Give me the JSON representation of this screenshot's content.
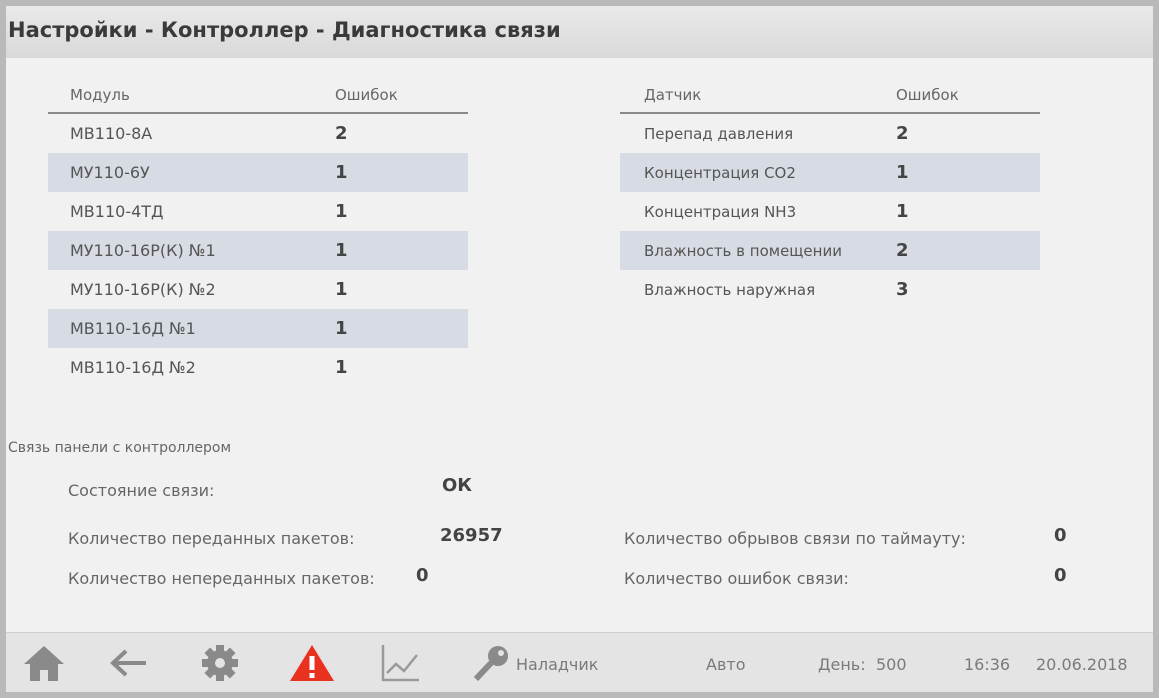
{
  "title": "Настройки - Контроллер - Диагностика связи",
  "modules_table": {
    "col_name": "Модуль",
    "col_errors": "Ошибок",
    "rows": [
      {
        "name": "МВ110-8А",
        "errors": "2"
      },
      {
        "name": "МУ110-6У",
        "errors": "1"
      },
      {
        "name": "МВ110-4ТД",
        "errors": "1"
      },
      {
        "name": "МУ110-16Р(К) №1",
        "errors": "1"
      },
      {
        "name": "МУ110-16Р(К) №2",
        "errors": "1"
      },
      {
        "name": "МВ110-16Д №1",
        "errors": "1"
      },
      {
        "name": "МВ110-16Д №2",
        "errors": "1"
      }
    ]
  },
  "sensors_table": {
    "col_name": "Датчик",
    "col_errors": "Ошибок",
    "rows": [
      {
        "name": "Перепад давления",
        "errors": "2"
      },
      {
        "name": "Концентрация СО2",
        "errors": "1"
      },
      {
        "name": "Концентрация NH3",
        "errors": "1"
      },
      {
        "name": "Влажность в помещении",
        "errors": "2"
      },
      {
        "name": "Влажность наружная",
        "errors": "3"
      }
    ]
  },
  "panel_link": {
    "section_label": "Связь панели с контроллером",
    "status_label": "Состояние связи:",
    "status_value": "ОК",
    "sent_label": "Количество переданных пакетов:",
    "sent_value": "26957",
    "unsent_label": "Количество непереданных пакетов:",
    "unsent_value": "0",
    "timeouts_label": "Количество обрывов связи по таймауту:",
    "timeouts_value": "0",
    "errors_label": "Количество ошибок связи:",
    "errors_value": "0"
  },
  "footer": {
    "icons": [
      "home-icon",
      "back-arrow-icon",
      "gear-icon",
      "alarm-warning-icon",
      "trend-chart-icon",
      "key-icon"
    ],
    "user": "Наладчик",
    "mode": "Авто",
    "day_label": "День:",
    "day_value": "500",
    "time": "16:36",
    "date": "20.06.2018"
  },
  "colors": {
    "warning_red": "#e8321f",
    "icon_gray": "#8a8a8a",
    "row_shade": "#d7dbe3"
  }
}
